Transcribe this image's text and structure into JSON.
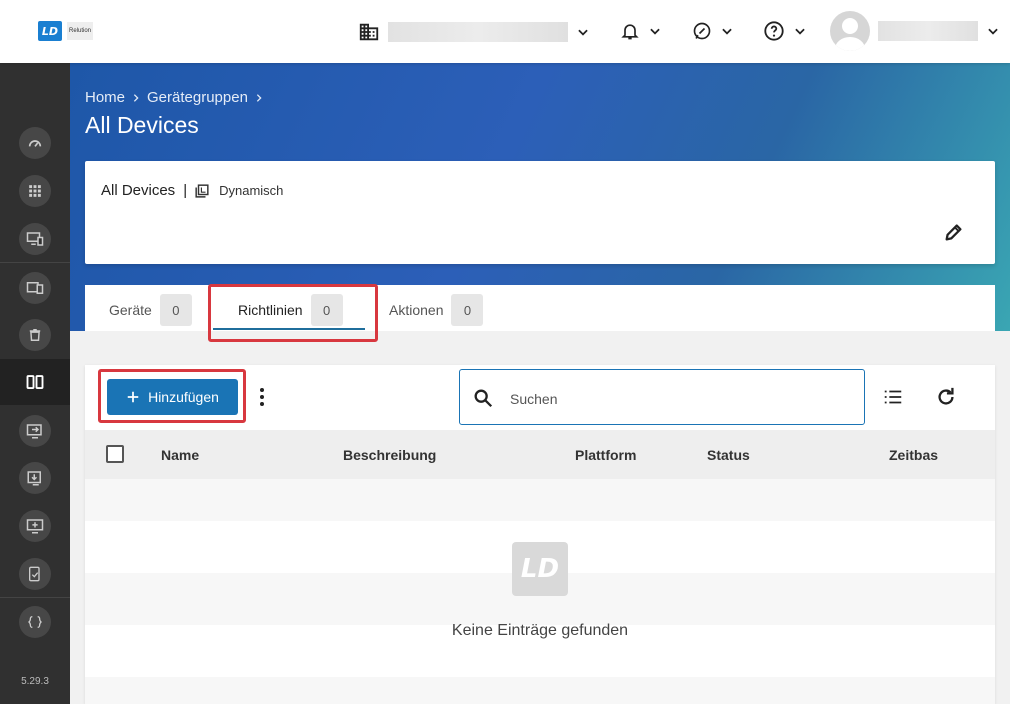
{
  "app": {
    "logo_mark": "LD",
    "logo_text": "Relution"
  },
  "topbar": {
    "org_label": "",
    "user_name": ""
  },
  "sidebar": {
    "items": [
      {
        "name": "dashboard-icon"
      },
      {
        "name": "apps-grid-icon"
      },
      {
        "name": "device-star-icon"
      },
      {
        "name": "devices-icon"
      },
      {
        "name": "trash-icon"
      },
      {
        "name": "device-groups-icon",
        "active": true
      },
      {
        "name": "device-arrow-icon"
      },
      {
        "name": "device-download-icon"
      },
      {
        "name": "device-add-icon"
      },
      {
        "name": "device-check-icon"
      },
      {
        "name": "code-icon"
      }
    ],
    "version": "5.29.3"
  },
  "breadcrumb": {
    "items": [
      "Home",
      "Gerätegruppen"
    ]
  },
  "page": {
    "title": "All Devices"
  },
  "info_card": {
    "name": "All Devices",
    "separator": "|",
    "type": "Dynamisch"
  },
  "tabs": [
    {
      "label": "Geräte",
      "count": "0"
    },
    {
      "label": "Richtlinien",
      "count": "0",
      "active": true
    },
    {
      "label": "Aktionen",
      "count": "0"
    }
  ],
  "toolbar": {
    "add_label": "Hinzufügen",
    "search_placeholder": "Suchen"
  },
  "table": {
    "columns": [
      "Name",
      "Beschreibung",
      "Plattform",
      "Status",
      "Zeitbas"
    ],
    "rows": [],
    "empty_text": "Keine Einträge gefunden"
  },
  "colors": {
    "primary": "#1a74b5",
    "highlight": "#d8383f",
    "sidebar": "#303030"
  }
}
